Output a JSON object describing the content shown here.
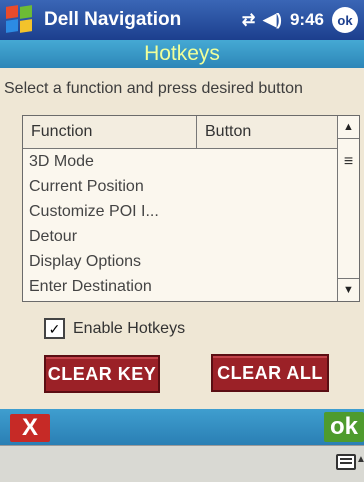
{
  "titlebar": {
    "app_title": "Dell Navigation",
    "time": "9:46",
    "ok_label": "ok"
  },
  "header": {
    "title": "Hotkeys"
  },
  "instruction": "Select a function and press desired button",
  "list": {
    "columns": [
      "Function",
      "Button"
    ],
    "rows": [
      "3D Mode",
      "Current Position",
      "Customize POI I...",
      "Detour",
      "Display Options",
      "Enter Destination"
    ]
  },
  "checkbox": {
    "label": "Enable Hotkeys",
    "checked": true
  },
  "buttons": {
    "clear_key": "CLEAR KEY",
    "clear_all": "CLEAR ALL"
  },
  "bottombar": {
    "cancel_label": "X",
    "ok_label": "ok"
  },
  "colors": {
    "title_bar": "#1c3f8e",
    "header": "#2d86b8",
    "button": "#9b2127",
    "ok": "#4e9b2d",
    "cancel": "#c62a26"
  }
}
